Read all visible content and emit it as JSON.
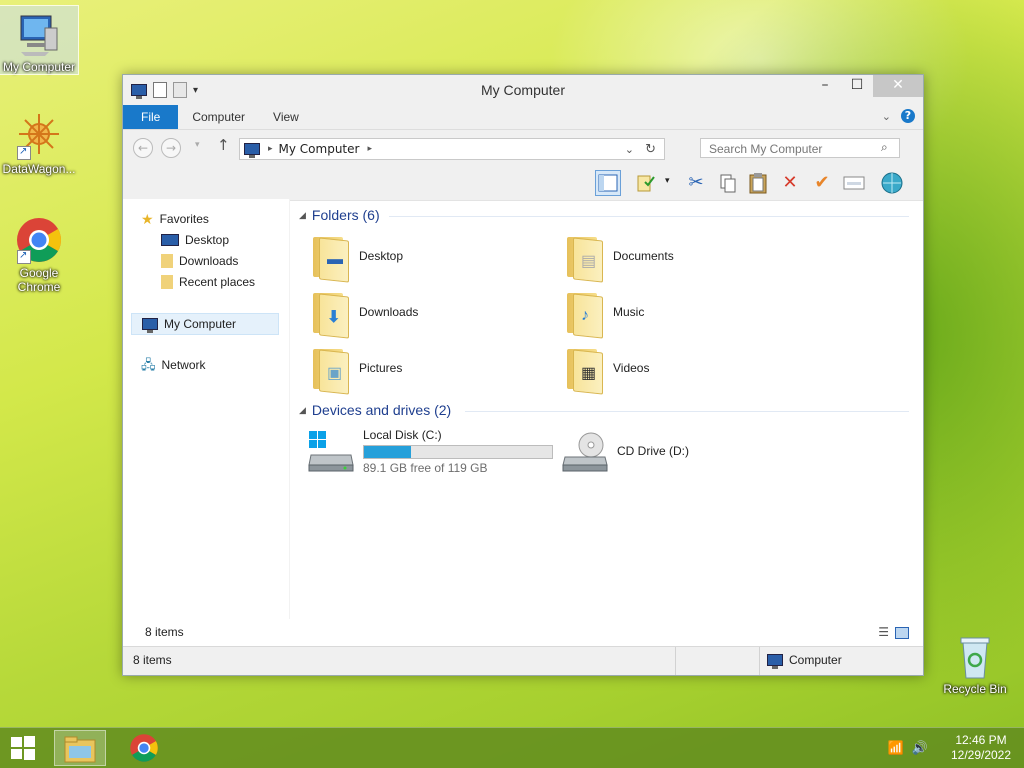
{
  "desktop": {
    "icons": [
      {
        "label": "My Computer"
      },
      {
        "label": "DataWagon..."
      },
      {
        "label": "Google Chrome"
      },
      {
        "label": "Recycle Bin"
      }
    ]
  },
  "window": {
    "title": "My Computer",
    "ribbon_tabs": [
      "File",
      "Computer",
      "View"
    ],
    "address": {
      "path": [
        "My Computer"
      ]
    },
    "search": {
      "placeholder": "Search My Computer"
    }
  },
  "nav_pane": {
    "favorites": {
      "label": "Favorites",
      "items": [
        "Desktop",
        "Downloads",
        "Recent places"
      ]
    },
    "computer": "My Computer",
    "network": "Network"
  },
  "content": {
    "folders_header": "Folders (6)",
    "folders": [
      {
        "name": "Desktop"
      },
      {
        "name": "Documents"
      },
      {
        "name": "Downloads"
      },
      {
        "name": "Music"
      },
      {
        "name": "Pictures"
      },
      {
        "name": "Videos"
      }
    ],
    "devices_header": "Devices and drives (2)",
    "drives": [
      {
        "name": "Local Disk (C:)",
        "free_text": "89.1 GB free of 119 GB",
        "used_fraction": 0.25
      },
      {
        "name": "CD Drive (D:)"
      }
    ]
  },
  "status": {
    "items_top": "8 items",
    "items_bottom": "8 items",
    "location": "Computer"
  },
  "taskbar": {
    "time": "12:46 PM",
    "date": "12/29/2022"
  },
  "colors": {
    "accent": "#1979ca",
    "drive_fill": "#26a0da",
    "folder_header": "#1f3f8f"
  }
}
